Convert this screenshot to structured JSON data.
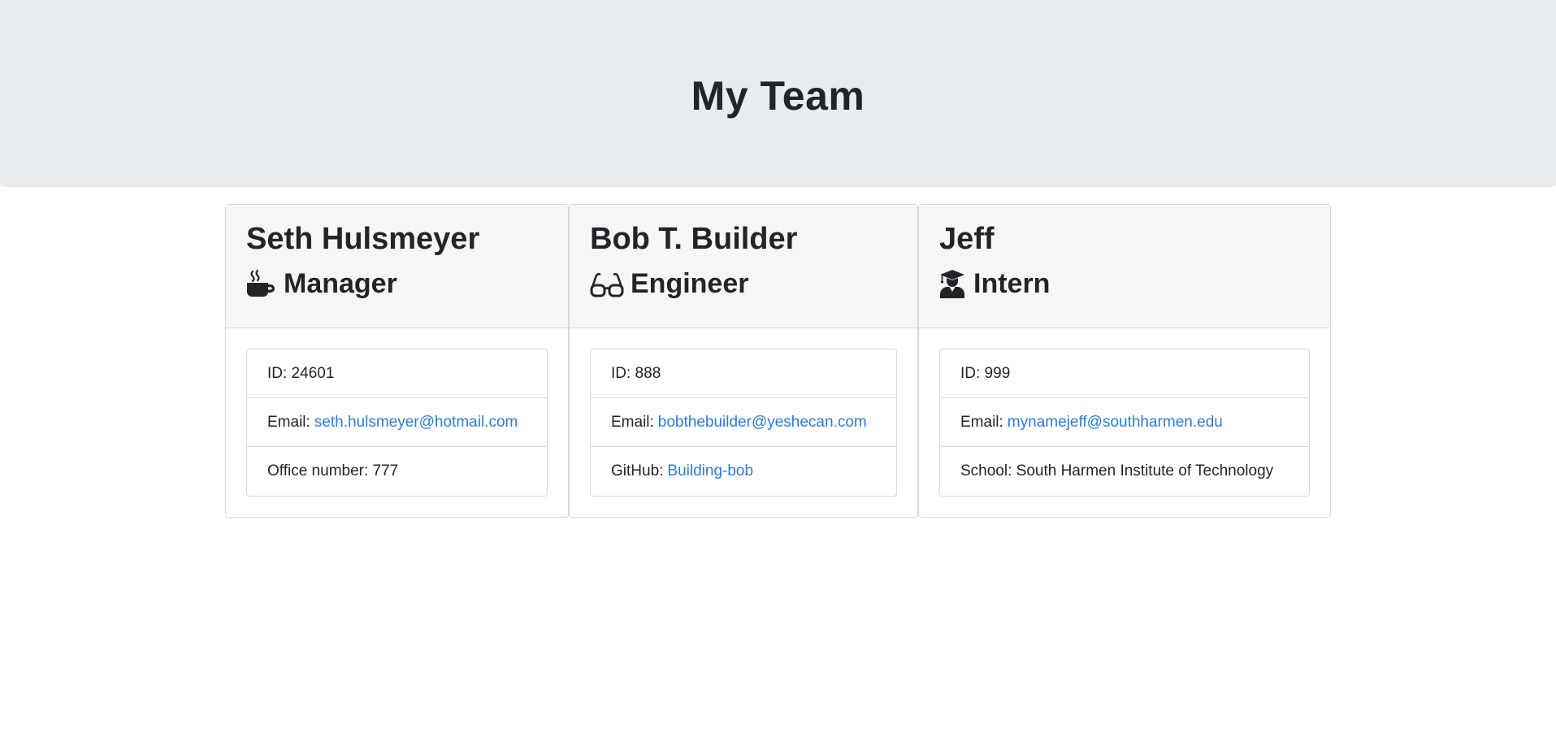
{
  "header": {
    "title": "My Team"
  },
  "team": [
    {
      "name": "Seth Hulsmeyer",
      "role": "Manager",
      "role_icon": "coffee-mug-icon",
      "id_label": "ID: 24601",
      "email_label": "Email:",
      "email": "seth.hulsmeyer@hotmail.com",
      "extra_label": "Office number: 777"
    },
    {
      "name": "Bob T. Builder",
      "role": "Engineer",
      "role_icon": "glasses-icon",
      "id_label": "ID: 888",
      "email_label": "Email:",
      "email": "bobthebuilder@yeshecan.com",
      "extra_label": "GitHub:",
      "extra_link": "Building-bob"
    },
    {
      "name": "Jeff",
      "role": "Intern",
      "role_icon": "graduate-icon",
      "id_label": "ID: 999",
      "email_label": "Email:",
      "email": "mynamejeff@southharmen.edu",
      "extra_label": "School: South Harmen Institute of Technology"
    }
  ],
  "colors": {
    "jumbotron": "#e9ecef",
    "card_header": "#f6f6f6",
    "link": "#2b7bdb",
    "text": "#212529",
    "border": "#d6d8db"
  }
}
